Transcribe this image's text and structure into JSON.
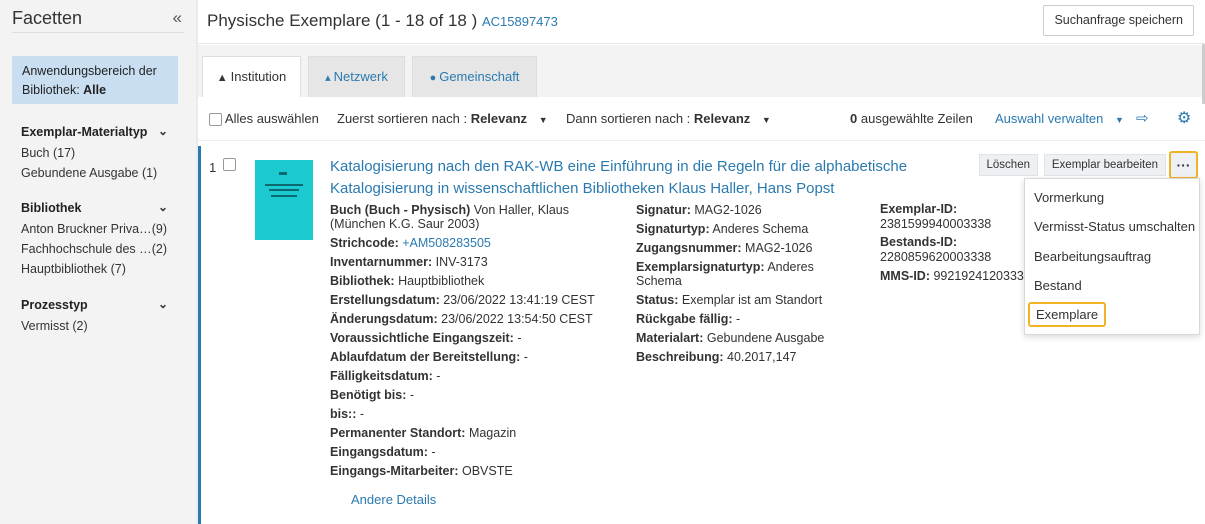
{
  "facets": {
    "title": "Facetten",
    "collapse_icon": "double-chevron-left-icon",
    "scope_prefix": "Anwendungsbereich der Bibliothek: ",
    "scope_value": "Alle",
    "groups": [
      {
        "title": "Exemplar-Materialtyp",
        "items": [
          {
            "label": "Buch (17)",
            "count": ""
          },
          {
            "label": "Gebundene Ausgabe (1)",
            "count": ""
          }
        ]
      },
      {
        "title": "Bibliothek",
        "items": [
          {
            "label": "Anton Bruckner Priva…",
            "count": "(9)"
          },
          {
            "label": "Fachhochschule des …",
            "count": "(2)"
          },
          {
            "label": "Hauptbibliothek (7)",
            "count": ""
          }
        ]
      },
      {
        "title": "Prozesstyp",
        "items": [
          {
            "label": "Vermisst (2)",
            "count": ""
          }
        ]
      }
    ]
  },
  "header": {
    "title": "Physische Exemplare (1 - 18 of 18 )",
    "record_id": "AC15897473",
    "save_search_label": "Suchanfrage speichern"
  },
  "tabs": [
    {
      "label": "Institution",
      "icon": "home-icon"
    },
    {
      "label": "Netzwerk",
      "icon": "network-icon"
    },
    {
      "label": "Gemeinschaft",
      "icon": "users-icon"
    }
  ],
  "toolbar": {
    "select_all": "Alles auswählen",
    "sort1_label": "Zuerst sortieren nach :",
    "sort1_value": "Relevanz",
    "sort2_label": "Dann sortieren nach :",
    "sort2_value": "Relevanz",
    "selected_count": "0",
    "selected_text": "ausgewählte Zeilen",
    "manage_selection": "Auswahl verwalten",
    "export_icon": "export-icon",
    "settings_icon": "gear-icon"
  },
  "result": {
    "number": "1",
    "title": "Katalogisierung nach den RAK-WB eine Einführung in die Regeln für die alphabetische Katalogisierung in wissenschaftlichen Bibliotheken Klaus Haller, Hans Popst",
    "delete_label": "Löschen",
    "edit_label": "Exemplar bearbeiten",
    "more_label": "···",
    "col1": {
      "type_bold": "Buch (Buch - Physisch)",
      "type_rest": " Von Haller, Klaus",
      "type_line2": "(München K.G. Saur 2003)",
      "barcode_label": "Strichcode:",
      "barcode_value": "+AM508283505",
      "fields": [
        {
          "label": "Inventarnummer:",
          "value": "INV-3173"
        },
        {
          "label": "Bibliothek:",
          "value": "Hauptbibliothek"
        },
        {
          "label": "Erstellungsdatum:",
          "value": "23/06/2022 13:41:19 CEST"
        },
        {
          "label": "Änderungsdatum:",
          "value": "23/06/2022 13:54:50 CEST"
        },
        {
          "label": "Voraussichtliche Eingangszeit:",
          "value": "-"
        },
        {
          "label": "Ablaufdatum der Bereitstellung:",
          "value": "-"
        },
        {
          "label": "Fälligkeitsdatum:",
          "value": "-"
        },
        {
          "label": "Benötigt bis:",
          "value": "-"
        },
        {
          "label": "bis::",
          "value": "-"
        },
        {
          "label": "Permanenter Standort:",
          "value": "Magazin"
        },
        {
          "label": "Eingangsdatum:",
          "value": "-"
        },
        {
          "label": "Eingangs-Mitarbeiter:",
          "value": "OBVSTE"
        }
      ]
    },
    "col2": {
      "fields": [
        {
          "label": "Signatur:",
          "value": "MAG2-1026"
        },
        {
          "label": "Signaturtyp:",
          "value": "Anderes Schema"
        },
        {
          "label": "Zugangsnummer:",
          "value": "MAG2-1026"
        },
        {
          "label": "Exemplarsignaturtyp:",
          "value": "Anderes"
        },
        {
          "label": "",
          "value": "Schema"
        },
        {
          "label": "Status:",
          "value": "Exemplar ist am Standort"
        },
        {
          "label": "Rückgabe fällig:",
          "value": "-"
        },
        {
          "label": "Materialart:",
          "value": "Gebundene Ausgabe"
        },
        {
          "label": "Beschreibung:",
          "value": "40.2017,147"
        }
      ]
    },
    "col3": {
      "exemplar_id_label": "Exemplar-ID:",
      "exemplar_id": "2381599940003338",
      "bestands_id_label": "Bestands-ID:",
      "bestands_id": "2280859620003338",
      "mms_id_label": "MMS-ID:",
      "mms_id": "9921924120333"
    },
    "other_details": "Andere Details"
  },
  "menu": {
    "items": [
      "Vormerkung",
      "Vermisst-Status umschalten",
      "Bearbeitungsauftrag",
      "Bestand",
      "Exemplare"
    ]
  },
  "colors": {
    "accent": "#2a7ab0",
    "highlight": "#f0b323",
    "thumb": "#1bc9d1"
  }
}
